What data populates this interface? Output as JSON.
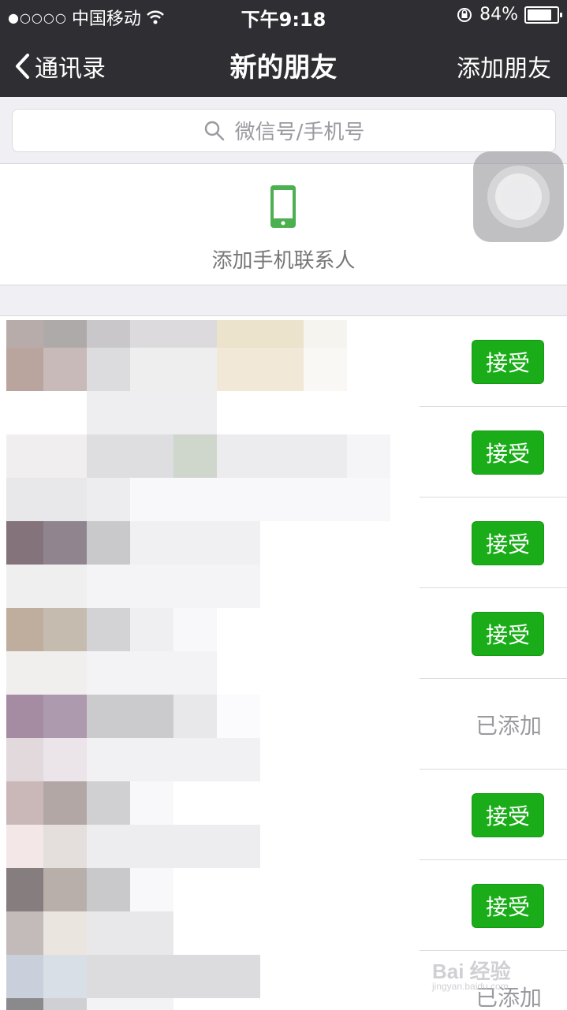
{
  "status": {
    "signal_dots": "●○○○○",
    "carrier": "中国移动",
    "time": "下午9:18",
    "battery": "84%",
    "battery_level": 0.84
  },
  "nav": {
    "back_label": "通讯录",
    "title": "新的朋友",
    "action_label": "添加朋友"
  },
  "search": {
    "placeholder": "微信号/手机号"
  },
  "add_contacts": {
    "label": "添加手机联系人",
    "icon": "phone-icon",
    "icon_color": "#4caf50"
  },
  "requests": [
    {
      "state": "accept",
      "label": "接受"
    },
    {
      "state": "accept",
      "label": "接受"
    },
    {
      "state": "accept",
      "label": "接受"
    },
    {
      "state": "accept",
      "label": "接受"
    },
    {
      "state": "added",
      "label": "已添加"
    },
    {
      "state": "accept",
      "label": "接受"
    },
    {
      "state": "accept",
      "label": "接受"
    },
    {
      "state": "added",
      "label": "已添加"
    }
  ],
  "colors": {
    "accent_green": "#1aad19",
    "nav_bg": "#2f2f33",
    "page_bg": "#efeff4"
  },
  "watermark": {
    "text": "Bai 经验",
    "sub": "jingyan.baidu.com"
  }
}
